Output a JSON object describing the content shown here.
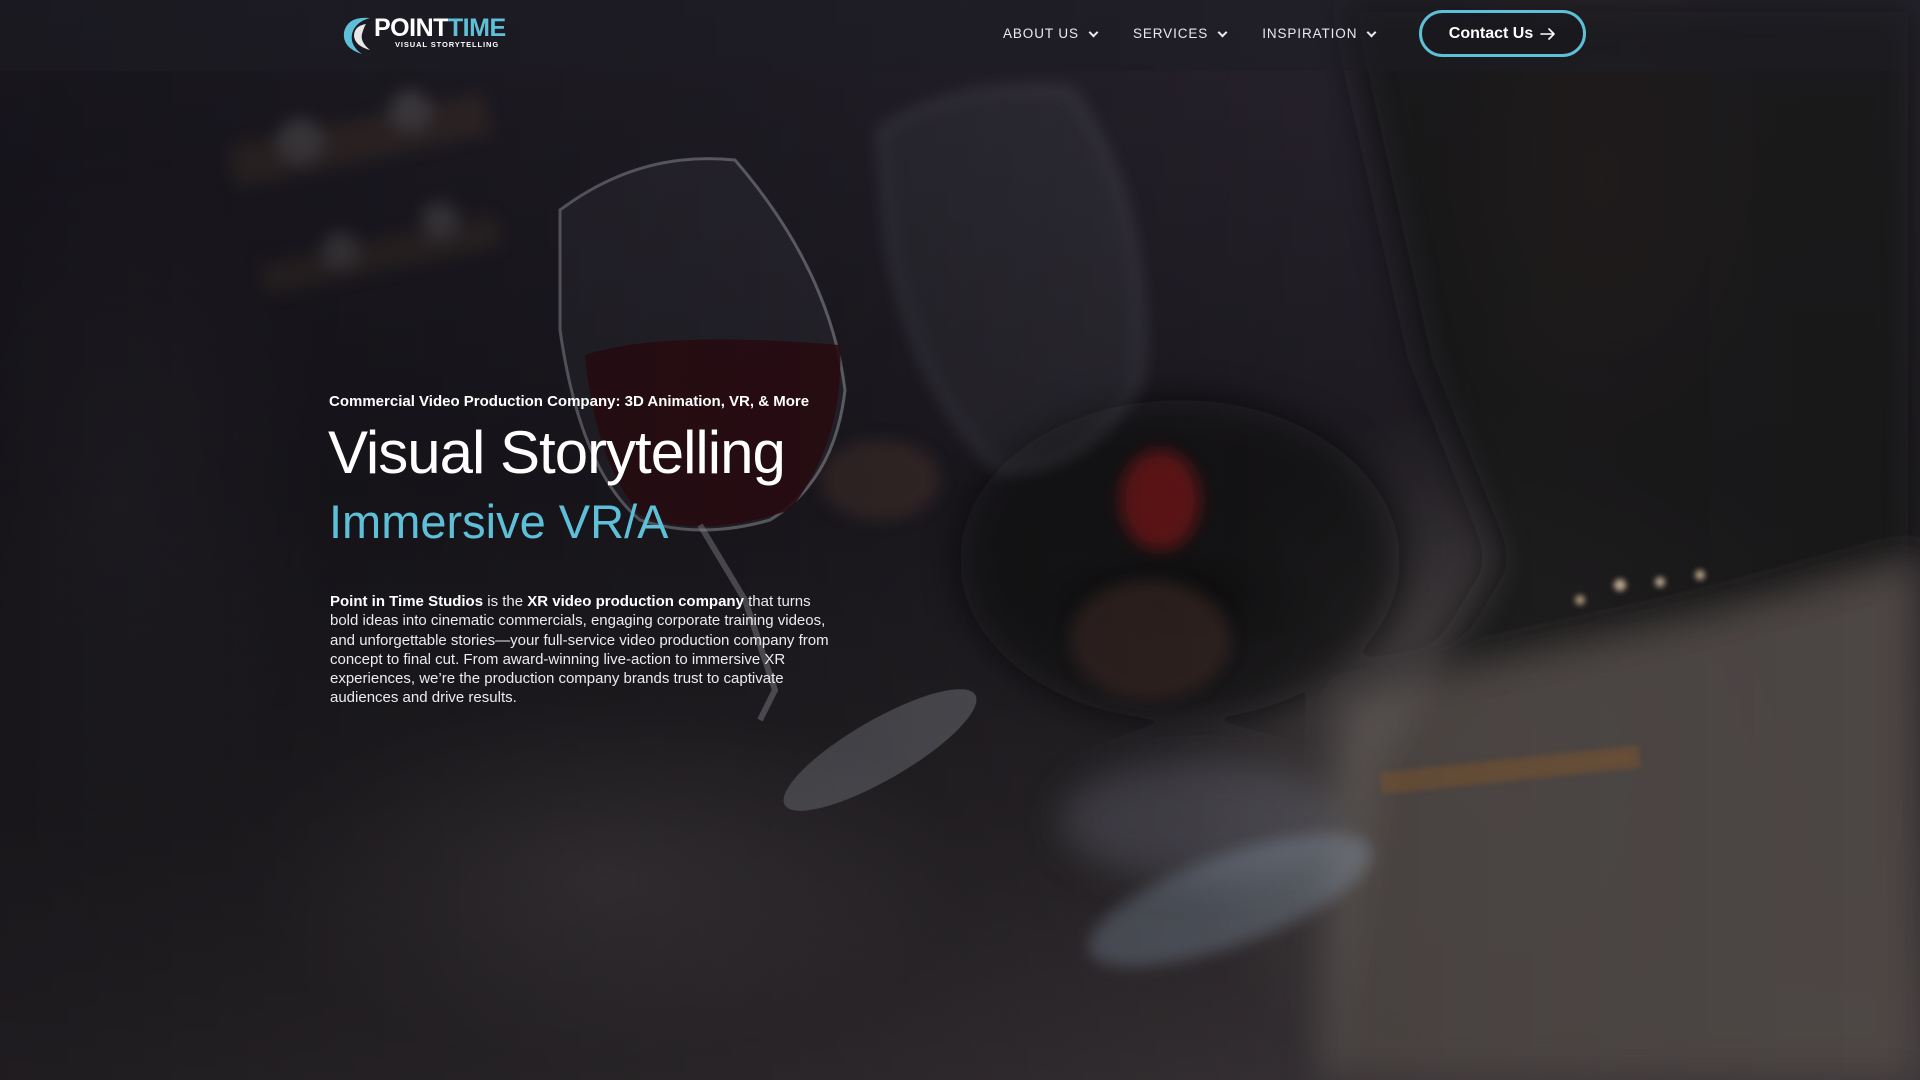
{
  "header": {
    "logo": {
      "word_part1": "POINT",
      "word_part2": "TIME",
      "tagline": "VISUAL STORYTELLING"
    },
    "nav": [
      {
        "label": "ABOUT US",
        "icon": "chevron-down-icon"
      },
      {
        "label": "SERVICES",
        "icon": "chevron-down-icon"
      },
      {
        "label": "INSPIRATION",
        "icon": "chevron-down-icon"
      }
    ],
    "contact_button": {
      "label": "Contact Us",
      "icon": "arrow-right-icon"
    }
  },
  "hero": {
    "kicker": "Commercial Video Production Company: 3D Animation, VR, & More",
    "title": "Visual Storytelling",
    "subtitle": "Immersive VR/A",
    "description": {
      "brand": "Point in Time Studios",
      "text1": " is the ",
      "highlight": "XR video production company",
      "text2": " that turns bold ideas into cinematic commercials, engaging corporate training videos, and unforgettable stories—your full-service video production company from concept to final cut. From award-winning live-action to immersive XR experiences, we’re the production company brands trust to captivate audiences and drive results."
    }
  },
  "colors": {
    "accent": "#5ec0d8",
    "text": "#ffffff",
    "header_bg": "rgba(30,30,36,0.55)"
  }
}
